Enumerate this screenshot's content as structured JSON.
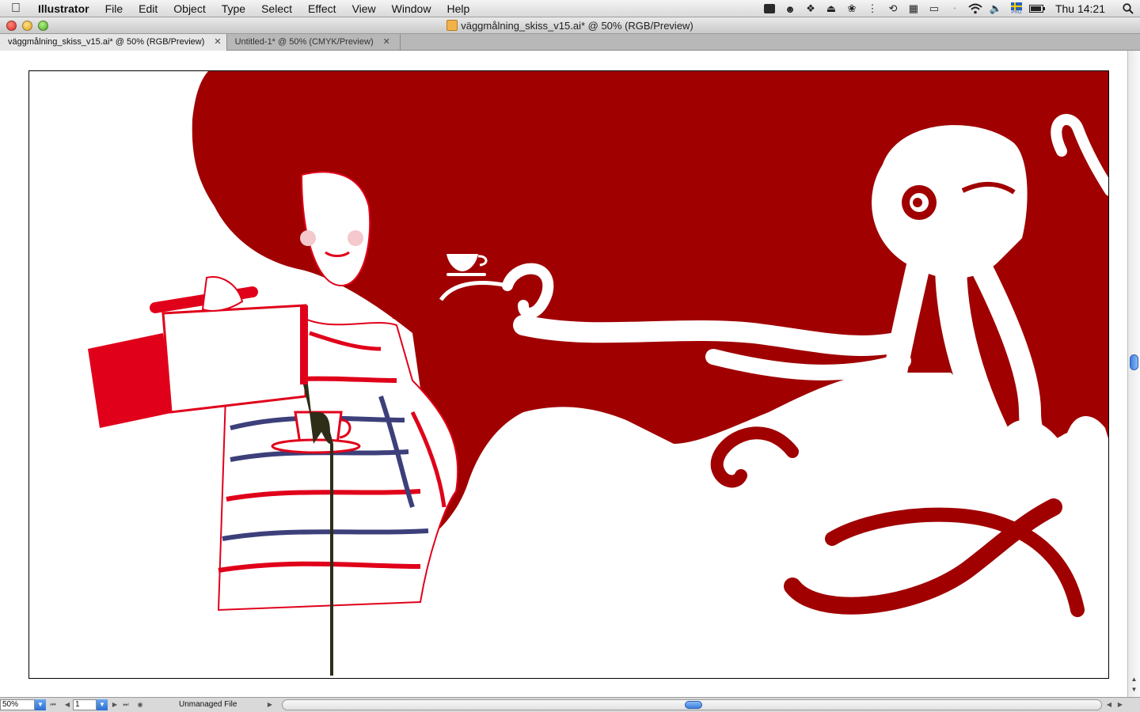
{
  "menubar": {
    "app_name": "Illustrator",
    "items": [
      "File",
      "Edit",
      "Object",
      "Type",
      "Select",
      "Effect",
      "View",
      "Window",
      "Help"
    ],
    "clock": "Thu 14:21",
    "status_icons": [
      "storage-icon",
      "robot-icon",
      "dropbox-icon",
      "eject-icon",
      "paw-icon",
      "separator-icon",
      "time-machine-icon",
      "spaces-icon",
      "display-icon",
      "bluetooth-icon",
      "wifi-icon",
      "volume-icon",
      "input-flag-icon",
      "battery-icon",
      "spotlight-icon"
    ],
    "input_badge": "PRO"
  },
  "window": {
    "title": "väggmålning_skiss_v15.ai* @ 50% (RGB/Preview)"
  },
  "tabs": [
    {
      "label": "väggmålning_skiss_v15.ai* @ 50% (RGB/Preview)",
      "active": true
    },
    {
      "label": "Untitled-1* @ 50% (CMYK/Preview)",
      "active": false
    }
  ],
  "statusbar": {
    "zoom": "50%",
    "page": "1",
    "file_status": "Unmanaged File"
  },
  "artwork": {
    "colors": {
      "red_background": "#a00000",
      "bright_red": "#e0001a",
      "stripe_red": "#e0001a",
      "stripe_blue": "#3c3f7a",
      "coffee": "#2e2d18",
      "white": "#ffffff"
    }
  }
}
